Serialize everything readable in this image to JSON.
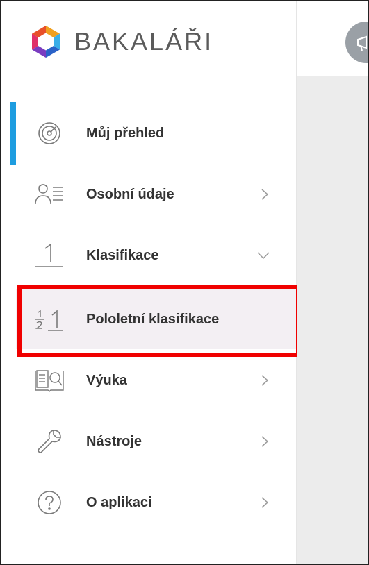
{
  "brand": {
    "name": "BAKALÁŘI"
  },
  "menu": [
    {
      "label": "Můj přehled",
      "icon": "dashboard-gauge-icon",
      "chevron": "none"
    },
    {
      "label": "Osobní údaje",
      "icon": "person-list-icon",
      "chevron": "right"
    },
    {
      "label": "Klasifikace",
      "icon": "grade-one-icon",
      "chevron": "down"
    },
    {
      "label": "Pololetní klasifikace",
      "icon": "half-grade-icon",
      "chevron": "none"
    },
    {
      "label": "Výuka",
      "icon": "book-search-icon",
      "chevron": "right"
    },
    {
      "label": "Nástroje",
      "icon": "wrench-icon",
      "chevron": "right"
    },
    {
      "label": "O aplikaci",
      "icon": "question-circle-icon",
      "chevron": "right"
    }
  ],
  "active_item": "Můj přehled",
  "highlighted_item": "Pololetní klasifikace",
  "colors": {
    "accent": "#1e9de0",
    "highlight_border": "#f00000",
    "text": "#333333"
  }
}
